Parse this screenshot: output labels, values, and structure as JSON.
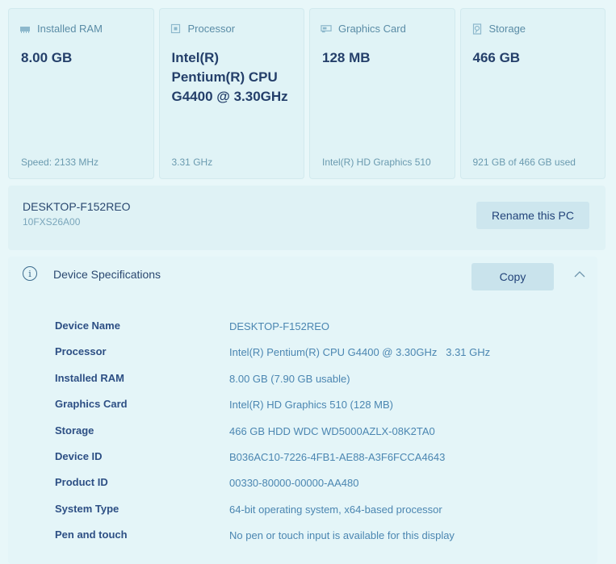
{
  "cards": [
    {
      "title": "Installed RAM",
      "icon": "ram-icon",
      "value": "8.00 GB",
      "footer": "Speed: 2133 MHz"
    },
    {
      "title": "Processor",
      "icon": "processor-icon",
      "value": "Intel(R) Pentium(R) CPU G4400 @ 3.30GHz",
      "footer": "3.31 GHz"
    },
    {
      "title": "Graphics Card",
      "icon": "graphics-card-icon",
      "value": "128 MB",
      "footer": "Intel(R) HD Graphics 510"
    },
    {
      "title": "Storage",
      "icon": "storage-icon",
      "value": "466 GB",
      "footer": "921 GB of 466 GB used"
    }
  ],
  "pc": {
    "name": "DESKTOP-F152REO",
    "model": "10FXS26A00",
    "rename_label": "Rename this PC"
  },
  "specs": {
    "title": "Device Specifications",
    "copy_label": "Copy",
    "rows": [
      {
        "label": "Device Name",
        "value": "DESKTOP-F152REO"
      },
      {
        "label": "Processor",
        "value": "Intel(R) Pentium(R) CPU G4400 @ 3.30GHz   3.31 GHz"
      },
      {
        "label": "Installed RAM",
        "value": "8.00 GB (7.90 GB usable)"
      },
      {
        "label": "Graphics Card",
        "value": "Intel(R) HD Graphics 510 (128 MB)"
      },
      {
        "label": "Storage",
        "value": "466 GB HDD WDC WD5000AZLX-08K2TA0"
      },
      {
        "label": "Device ID",
        "value": "B036AC10-7226-4FB1-AE88-A3F6FCCA4643"
      },
      {
        "label": "Product ID",
        "value": "00330-80000-00000-AA480"
      },
      {
        "label": "System Type",
        "value": "64-bit operating system, x64-based processor"
      },
      {
        "label": "Pen and touch",
        "value": "No pen or touch input is available for this display"
      }
    ]
  }
}
